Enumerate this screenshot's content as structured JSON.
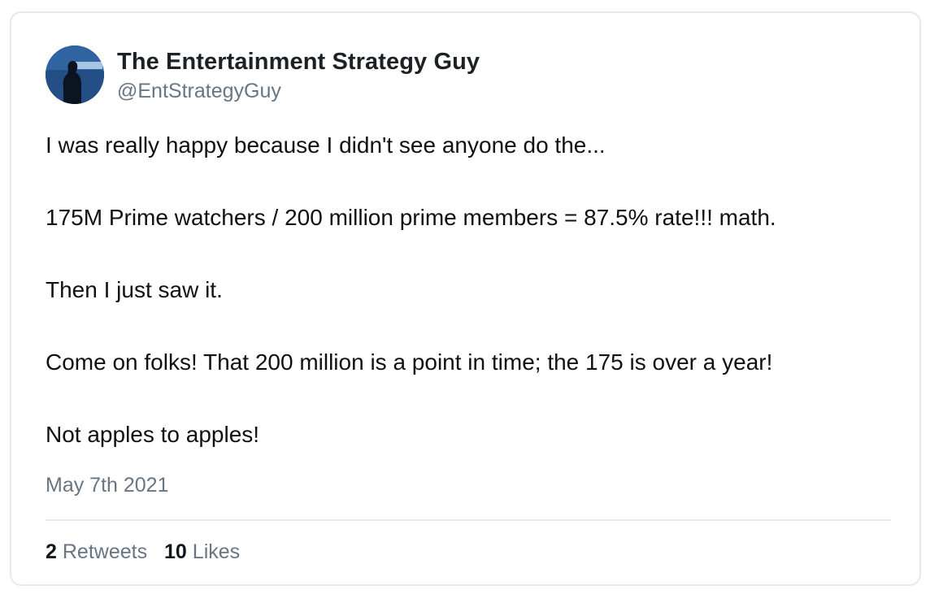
{
  "tweet": {
    "author": {
      "display_name": "The Entertainment Strategy Guy",
      "handle": "@EntStrategyGuy"
    },
    "paragraphs": [
      "I was really happy because I didn't see anyone do the...",
      "175M Prime watchers / 200 million prime members = 87.5% rate!!! math.",
      "Then I just saw it.",
      "Come on folks! That 200 million is a point in time; the 175 is over a year!",
      "Not apples to apples!"
    ],
    "date": "May 7th 2021",
    "stats": {
      "retweets_count": "2",
      "retweets_label": "Retweets",
      "likes_count": "10",
      "likes_label": "Likes"
    }
  }
}
